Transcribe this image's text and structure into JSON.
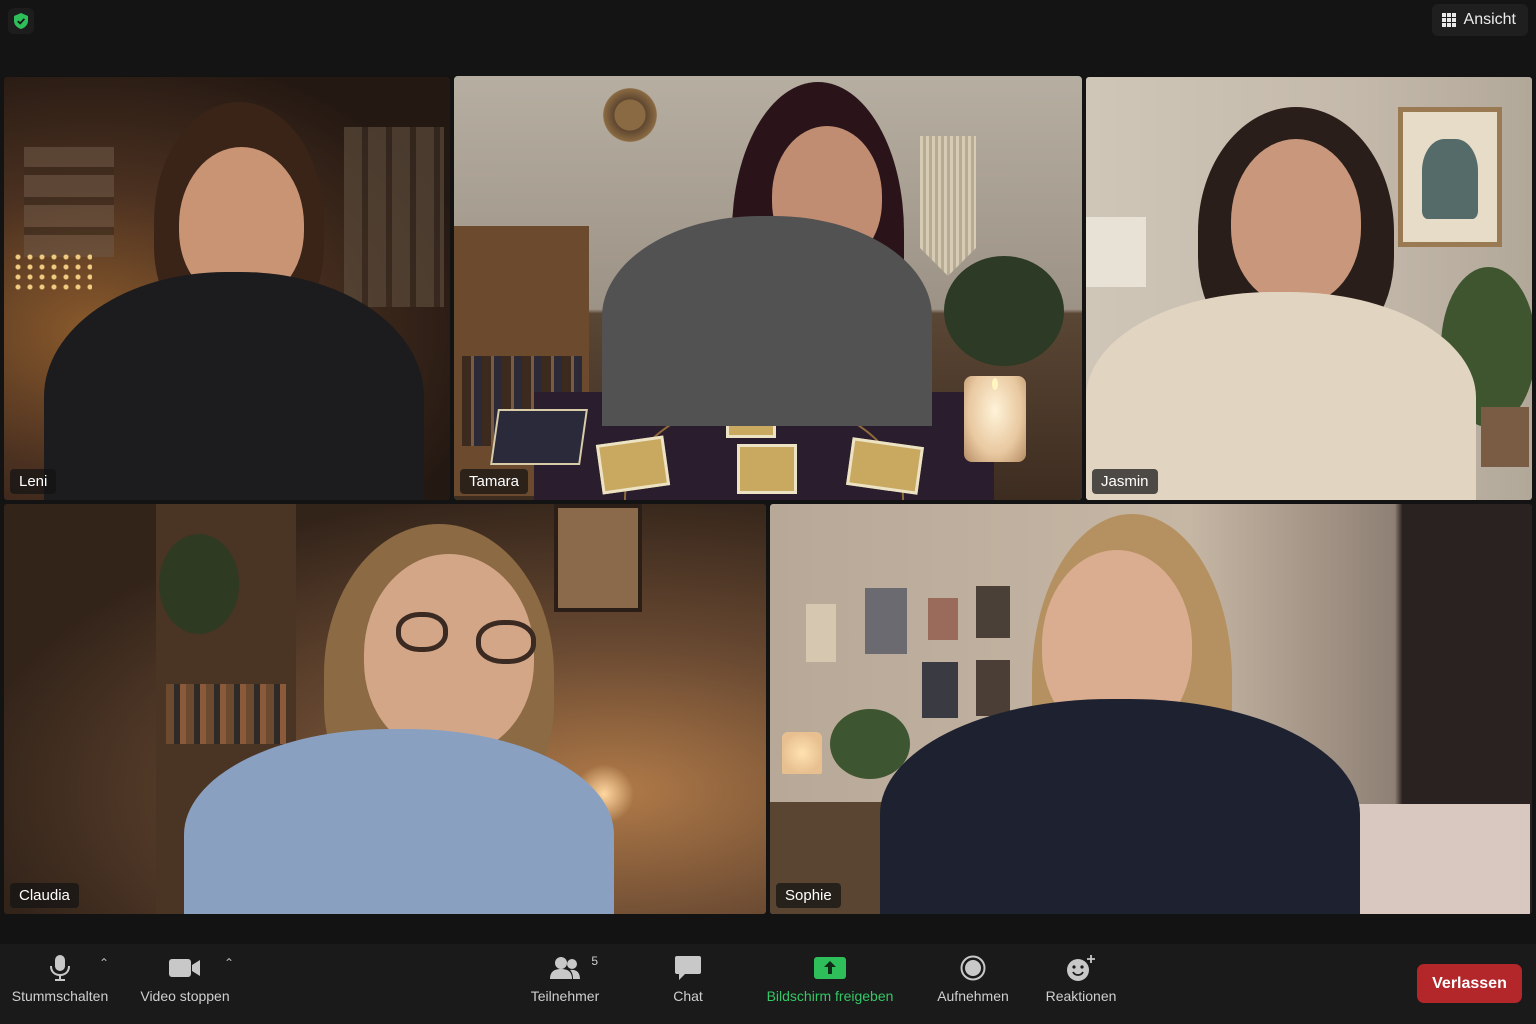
{
  "header": {
    "view_label": "Ansicht"
  },
  "participants": [
    {
      "name": "Leni"
    },
    {
      "name": "Tamara"
    },
    {
      "name": "Jasmin"
    },
    {
      "name": "Claudia"
    },
    {
      "name": "Sophie"
    }
  ],
  "active_speaker": "Tamara",
  "toolbar": {
    "mute_label": "Stummschalten",
    "video_label": "Video stoppen",
    "participants_label": "Teilnehmer",
    "participants_count": "5",
    "chat_label": "Chat",
    "share_label": "Bildschirm freigeben",
    "record_label": "Aufnehmen",
    "reactions_label": "Reaktionen",
    "leave_label": "Verlassen"
  },
  "colors": {
    "active_border": "#39c96b",
    "share_green": "#34c765",
    "leave_red": "#b3262a",
    "security_green": "#2fbf5a"
  },
  "icons": [
    "shield-check-icon",
    "grid-view-icon",
    "microphone-icon",
    "camera-icon",
    "people-icon",
    "chat-bubble-icon",
    "share-screen-icon",
    "record-icon",
    "emoji-plus-icon",
    "caret-up-icon"
  ]
}
